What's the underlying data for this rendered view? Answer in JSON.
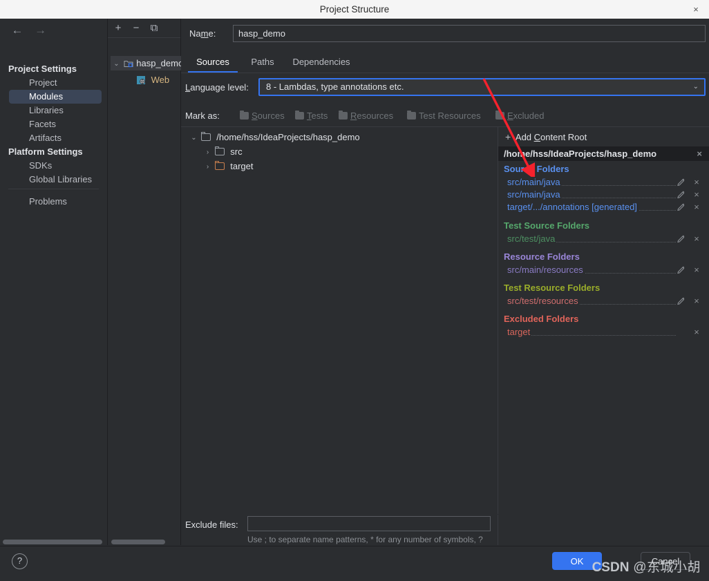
{
  "window": {
    "title": "Project Structure",
    "close_label": "×"
  },
  "nav": {
    "back_icon": "←",
    "forward_icon": "→"
  },
  "sidebar": {
    "groups": [
      {
        "title": "Project Settings"
      },
      {
        "title": "Platform Settings"
      }
    ],
    "items": [
      {
        "label": "Project",
        "selected": false
      },
      {
        "label": "Modules",
        "selected": true
      },
      {
        "label": "Libraries",
        "selected": false
      },
      {
        "label": "Facets",
        "selected": false
      },
      {
        "label": "Artifacts",
        "selected": false
      },
      {
        "label": "SDKs",
        "selected": false
      },
      {
        "label": "Global Libraries",
        "selected": false
      },
      {
        "label": "Problems",
        "selected": false
      }
    ]
  },
  "modules_panel": {
    "toolbar": {
      "add_label": "+",
      "remove_label": "−",
      "copy_label": "⧉"
    },
    "tree": [
      {
        "label": "hasp_demo",
        "chevron": "⌄",
        "selected": true
      },
      {
        "label": "Web",
        "chevron": "",
        "selected": false
      }
    ]
  },
  "main": {
    "name_label": "Name:",
    "name_value": "hasp_demo",
    "tabs": [
      {
        "label": "Sources",
        "active": true
      },
      {
        "label": "Paths",
        "active": false
      },
      {
        "label": "Dependencies",
        "active": false
      }
    ],
    "language_level_label": "Language level:",
    "language_level_value": "8 - Lambdas, type annotations etc.",
    "language_level_caret": "⌄",
    "mark_as_label": "Mark as:",
    "mark_as_buttons": [
      {
        "label": "Sources",
        "mnemonic": "S"
      },
      {
        "label": "Tests",
        "mnemonic": "T"
      },
      {
        "label": "Resources",
        "mnemonic": "R"
      },
      {
        "label": "Test Resources",
        "mnemonic": ""
      },
      {
        "label": "Excluded",
        "mnemonic": "E"
      }
    ],
    "content_tree": [
      {
        "label": "/home/hss/IdeaProjects/hasp_demo",
        "chevron": "⌄",
        "depth": 0,
        "kind": "normal"
      },
      {
        "label": "src",
        "chevron": "›",
        "depth": 1,
        "kind": "normal"
      },
      {
        "label": "target",
        "chevron": "›",
        "depth": 1,
        "kind": "excluded"
      }
    ],
    "exclude_files_label": "Exclude files:",
    "exclude_files_value": "",
    "exclude_files_hint": "Use ; to separate name patterns, * for any number of symbols, ? for one."
  },
  "roots": {
    "add_content_root_label": "Add Content Root",
    "add_icon": "+",
    "content_root_path": "/home/hss/IdeaProjects/hasp_demo",
    "content_root_remove": "×",
    "sections": [
      {
        "title": "Source Folders",
        "color": "#5a91f0",
        "item_color": "#5a91f0",
        "items": [
          {
            "path": "src/main/java",
            "editable": true,
            "removable": true
          },
          {
            "path": "src/main/java",
            "editable": true,
            "removable": true
          },
          {
            "path": "target/.../annotations [generated]",
            "editable": true,
            "removable": true
          }
        ]
      },
      {
        "title": "Test Source Folders",
        "color": "#56a86c",
        "item_color": "#4d8f61",
        "items": [
          {
            "path": "src/test/java",
            "editable": true,
            "removable": true
          }
        ]
      },
      {
        "title": "Resource Folders",
        "color": "#9a86d8",
        "item_color": "#8a7bc4",
        "items": [
          {
            "path": "src/main/resources",
            "editable": true,
            "removable": true
          }
        ]
      },
      {
        "title": "Test Resource Folders",
        "color": "#9aad2a",
        "item_color": "#d06e6e",
        "items": [
          {
            "path": "src/test/resources",
            "editable": true,
            "removable": true
          }
        ]
      },
      {
        "title": "Excluded Folders",
        "color": "#e0645a",
        "item_color": "#d8665c",
        "items": [
          {
            "path": "target",
            "editable": false,
            "removable": true
          }
        ]
      }
    ]
  },
  "footer": {
    "help_label": "?",
    "ok_label": "OK",
    "cancel_label": "Cancel"
  },
  "annotation": {
    "arrow_color": "#f5222d"
  },
  "watermark": {
    "brand": "CSDN",
    "handle": "@东城小胡"
  }
}
